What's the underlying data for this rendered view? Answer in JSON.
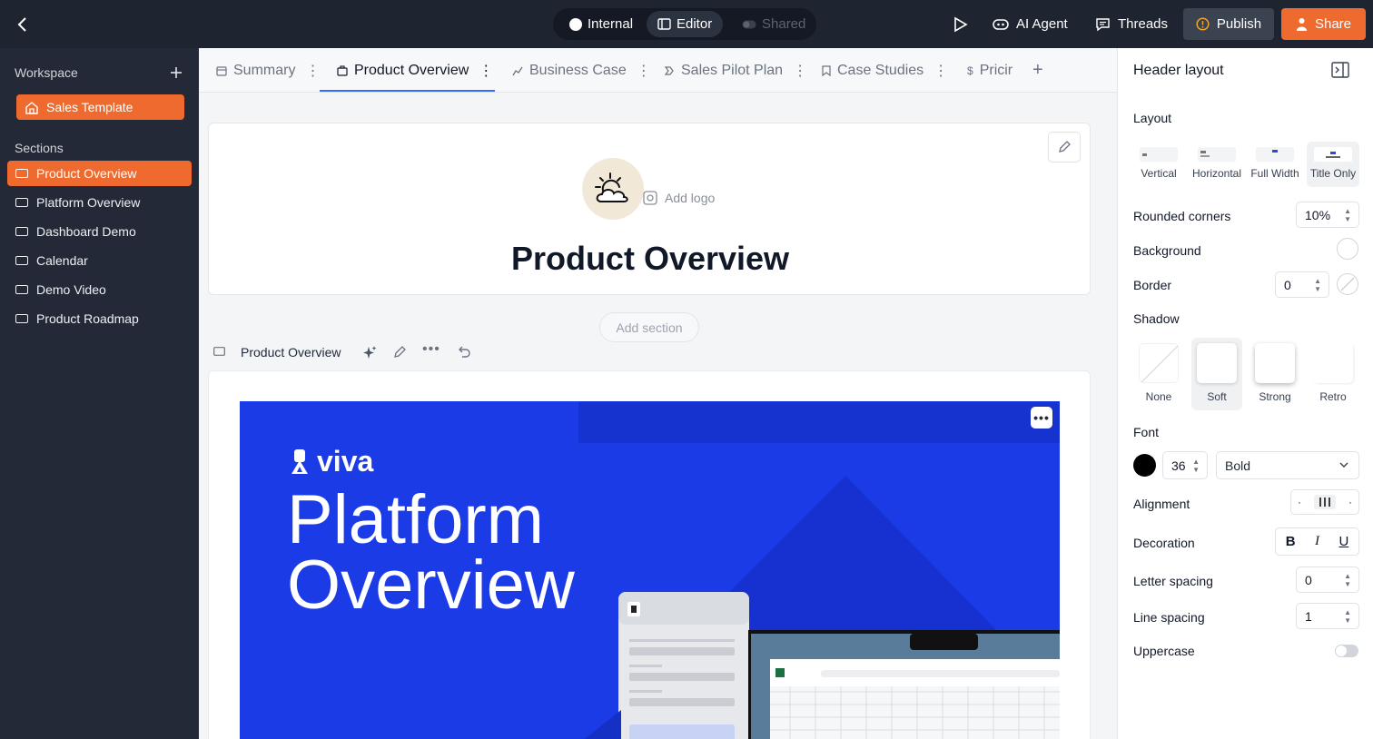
{
  "topbar": {
    "modes": {
      "internal": "Internal",
      "editor": "Editor",
      "shared": "Shared"
    },
    "ai_agent": "AI Agent",
    "threads": "Threads",
    "publish": "Publish",
    "share": "Share"
  },
  "sidebar": {
    "workspace_label": "Workspace",
    "template_label": "Sales Template",
    "sections_label": "Sections",
    "items": [
      {
        "label": "Product Overview"
      },
      {
        "label": "Platform Overview"
      },
      {
        "label": "Dashboard Demo"
      },
      {
        "label": "Calendar"
      },
      {
        "label": "Demo Video"
      },
      {
        "label": "Product Roadmap"
      }
    ]
  },
  "tabs": [
    {
      "label": "Summary",
      "icon": "calendar-icon"
    },
    {
      "label": "Product Overview",
      "icon": "briefcase-icon"
    },
    {
      "label": "Business Case",
      "icon": "chart-icon"
    },
    {
      "label": "Sales Pilot Plan",
      "icon": "steps-icon"
    },
    {
      "label": "Case Studies",
      "icon": "bookmark-icon"
    },
    {
      "label": "Pricir",
      "icon": "dollar-icon"
    }
  ],
  "header_card": {
    "add_logo": "Add logo",
    "title": "Product Overview"
  },
  "add_section": "Add section",
  "section_toolbar": {
    "label": "Product Overview"
  },
  "hero": {
    "brand": "viva",
    "title": "Platform Overview",
    "menu": "•••",
    "accent": "#1a3be6"
  },
  "panel": {
    "title": "Header layout",
    "layout_label": "Layout",
    "layout_options": [
      "Vertical",
      "Horizontal",
      "Full Width",
      "Title Only"
    ],
    "layout_selected": "Title Only",
    "rounded_corners_label": "Rounded corners",
    "rounded_corners": "10%",
    "background_label": "Background",
    "border_label": "Border",
    "border_value": "0",
    "shadow_label": "Shadow",
    "shadow_options": [
      "None",
      "Soft",
      "Strong",
      "Retro"
    ],
    "shadow_selected": "Soft",
    "font_label": "Font",
    "font_size": "36",
    "font_weight": "Bold",
    "alignment_label": "Alignment",
    "decoration_label": "Decoration",
    "decoration": {
      "bold": "B",
      "italic": "I",
      "underline": "U"
    },
    "letter_spacing_label": "Letter spacing",
    "letter_spacing": "0",
    "line_spacing_label": "Line spacing",
    "line_spacing": "1",
    "uppercase_label": "Uppercase",
    "uppercase_on": false
  },
  "colors": {
    "brand_orange": "#ef6a2e",
    "topbar": "#1e2430",
    "sidebar": "#232936",
    "tab_accent": "#3b6cf6"
  }
}
